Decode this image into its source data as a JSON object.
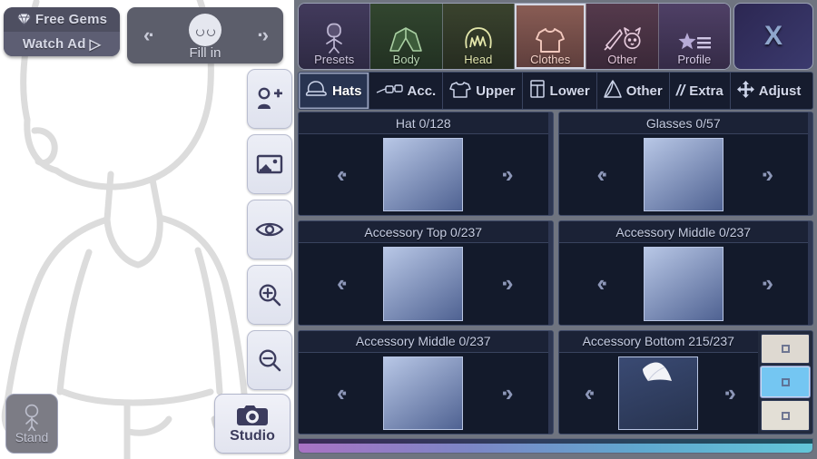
{
  "stage": {
    "gems": {
      "icon": "gem-icon",
      "line1": "Free Gems",
      "line2": "Watch Ad",
      "play": "▷"
    },
    "fill_in": {
      "prev": "‹·",
      "next": "·›",
      "label": "Fill in",
      "icon": "face-icon"
    },
    "tools": [
      {
        "name": "add-character-icon",
        "label": ""
      },
      {
        "name": "background-image-icon",
        "label": ""
      },
      {
        "name": "eye-visibility-icon",
        "label": ""
      },
      {
        "name": "zoom-in-icon",
        "label": ""
      },
      {
        "name": "zoom-out-icon",
        "label": ""
      }
    ],
    "stand": {
      "label": "Stand",
      "icon": "standing-pose-icon"
    },
    "studio": {
      "label": "Studio",
      "icon": "camera-icon"
    }
  },
  "panel": {
    "tabs": [
      {
        "label": "Presets",
        "icon": "character-icon",
        "color": "#3b3550",
        "text": "#cfc7df",
        "selected": false
      },
      {
        "label": "Body",
        "icon": "shirt-body-icon",
        "color": "#2f4033",
        "text": "#b9d6b4",
        "selected": false
      },
      {
        "label": "Head",
        "icon": "hair-icon",
        "color": "#36412f",
        "text": "#dfe3ab",
        "selected": false
      },
      {
        "label": "Clothes",
        "icon": "tshirt-icon",
        "color": "#744f49",
        "text": "#f0c4ba",
        "selected": true
      },
      {
        "label": "Other",
        "icon": "sword-cat-icon",
        "color": "#4b3444",
        "text": "#e3c6da",
        "selected": false
      },
      {
        "label": "Profile",
        "icon": "star-list-icon",
        "color": "#493a5a",
        "text": "#d9cdea",
        "selected": false
      }
    ],
    "close_label": "X",
    "subtabs": [
      {
        "label": "Hats",
        "icon": "cap-icon",
        "selected": true
      },
      {
        "label": "Acc.",
        "icon": "glasses-icon",
        "selected": false
      },
      {
        "label": "Upper",
        "icon": "tshirt-icon",
        "selected": false
      },
      {
        "label": "Lower",
        "icon": "pants-icon",
        "selected": false
      },
      {
        "label": "Other",
        "icon": "cape-icon",
        "selected": false
      },
      {
        "label": "Extra",
        "icon": "slashes-icon",
        "selected": false
      },
      {
        "label": "Adjust",
        "icon": "move-arrows-icon",
        "selected": false
      }
    ],
    "slots": [
      {
        "title": "Hat 0/128",
        "prev": "‹·",
        "next": "·›",
        "has_item": false,
        "swatches": []
      },
      {
        "title": "Glasses 0/57",
        "prev": "‹·",
        "next": "·›",
        "has_item": false,
        "swatches": []
      },
      {
        "title": "Accessory Top 0/237",
        "prev": "‹·",
        "next": "·›",
        "has_item": false,
        "swatches": []
      },
      {
        "title": "Accessory Middle 0/237",
        "prev": "‹·",
        "next": "·›",
        "has_item": false,
        "swatches": []
      },
      {
        "title": "Accessory Middle 0/237",
        "prev": "‹·",
        "next": "·›",
        "has_item": false,
        "swatches": []
      },
      {
        "title": "Accessory Bottom 215/237",
        "prev": "‹·",
        "next": "·›",
        "has_item": true,
        "swatches": [
          {
            "color": "#ded9d1",
            "selected": false
          },
          {
            "color": "#74c6f2",
            "selected": true
          },
          {
            "color": "#e3dfd6",
            "selected": false
          }
        ]
      }
    ]
  },
  "colors": {
    "accent_cyan": "#74c6f2",
    "panel_bg": "#6f7480",
    "cell_bg": "#222a3d",
    "bar_left": "#a972c4",
    "bar_right": "#63c6d8"
  }
}
